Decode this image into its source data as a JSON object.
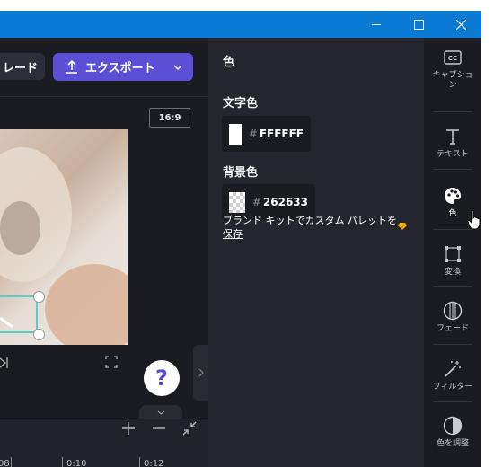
{
  "editor": {
    "upgrade_label": "レード",
    "export_label": "エクスポート",
    "aspect_ratio": "16:9",
    "help_label": "?"
  },
  "timeline": {
    "ticks": [
      "08",
      "0:10",
      "0:12"
    ]
  },
  "panel": {
    "title": "色",
    "text_color_label": "文字色",
    "text_color_hex": "FFFFFF",
    "bg_color_label": "背景色",
    "bg_color_hex": "262633",
    "brand_text": "ブランド キットで",
    "brand_link": "カスタム パレットを保存"
  },
  "rail": {
    "items": [
      {
        "label": "キャプショ\nン",
        "icon": "captions-icon"
      },
      {
        "label": "テキスト",
        "icon": "text-icon"
      },
      {
        "label": "色",
        "icon": "palette-icon",
        "active": true
      },
      {
        "label": "変換",
        "icon": "transform-icon"
      },
      {
        "label": "フェード",
        "icon": "fade-icon"
      },
      {
        "label": "フィルター",
        "icon": "magic-wand-icon"
      },
      {
        "label": "色を調整",
        "icon": "adjust-color-icon"
      }
    ]
  },
  "colors": {
    "accent": "#5b4fd6",
    "titlebar": "#0a7ad4",
    "selection": "#58cfc0"
  }
}
